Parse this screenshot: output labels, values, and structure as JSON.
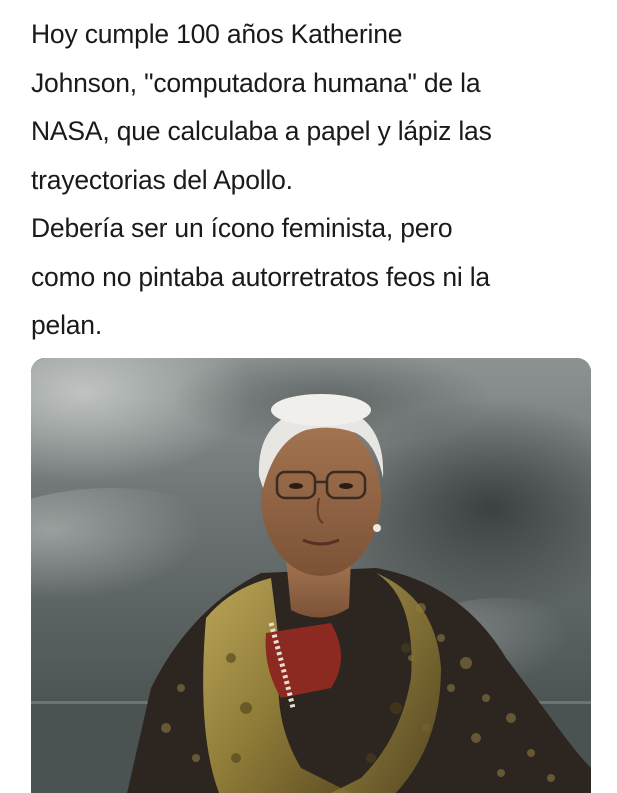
{
  "post": {
    "text": "Hoy cumple 100 años Katherine\nJohnson, \"computadora humana\" de la\nNASA, que calculaba a papel y lápiz las\ntrayectorias del Apollo.\nDebería ser un ícono feminista, pero\ncomo no pintaba autorretratos feos ni la\npelan."
  },
  "photo": {
    "icon": "portrait-photo-icon"
  }
}
